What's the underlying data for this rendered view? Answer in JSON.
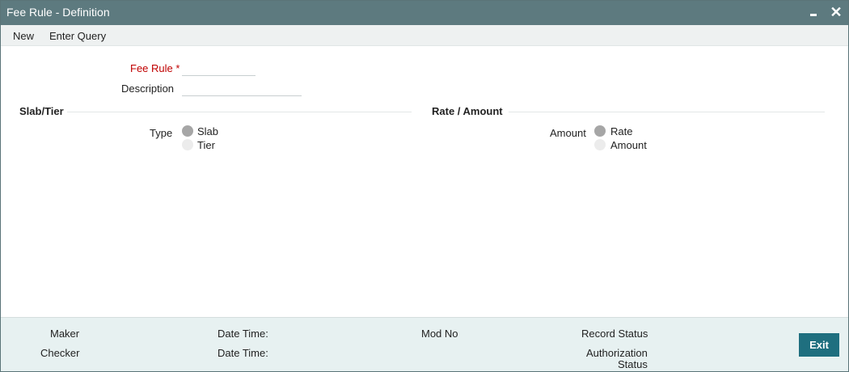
{
  "window": {
    "title": "Fee Rule - Definition",
    "minimize_label": "",
    "close_label": "✕"
  },
  "menu": {
    "new_label": "New",
    "enter_query_label": "Enter Query"
  },
  "form": {
    "fee_rule_label": "Fee Rule",
    "required_marker": "*",
    "fee_rule_value": "",
    "description_label": "Description",
    "description_value": ""
  },
  "slab_tier": {
    "section_title": "Slab/Tier",
    "type_label": "Type",
    "options": [
      {
        "label": "Slab",
        "checked": true
      },
      {
        "label": "Tier",
        "checked": false
      }
    ]
  },
  "rate_amount": {
    "section_title": "Rate / Amount",
    "amount_label": "Amount",
    "options": [
      {
        "label": "Rate",
        "checked": true
      },
      {
        "label": "Amount",
        "checked": false
      }
    ]
  },
  "footer": {
    "maker_label": "Maker",
    "checker_label": "Checker",
    "date_time_label_1": "Date Time:",
    "date_time_label_2": "Date Time:",
    "mod_no_label": "Mod No",
    "record_status_label": "Record Status",
    "authorization_status_label_line1": "Authorization",
    "authorization_status_label_line2": "Status",
    "exit_label": "Exit"
  }
}
